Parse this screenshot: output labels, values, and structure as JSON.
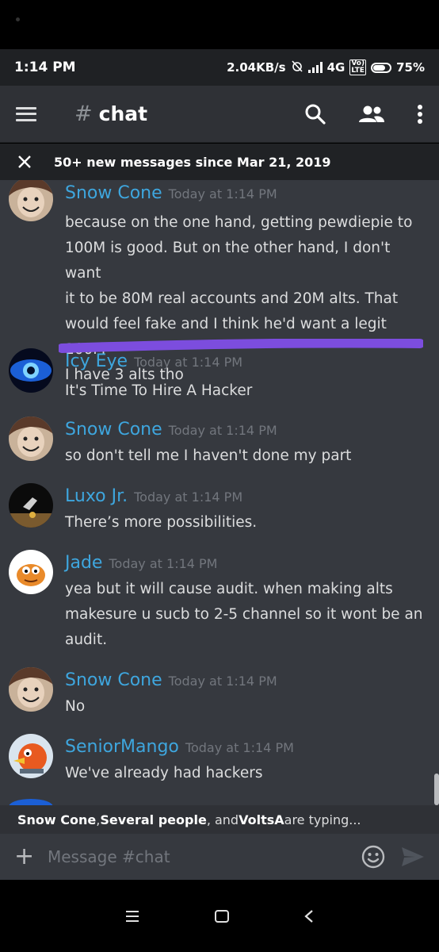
{
  "status": {
    "time": "1:14 PM",
    "network_speed": "2.04KB/s",
    "network_type": "4G",
    "lte_top": "Vo)",
    "lte_bottom": "LTE",
    "battery": "75%",
    "battery_level": 0.75
  },
  "header": {
    "hash": "#",
    "channel": "chat",
    "icons": [
      "menu-icon",
      "search-icon",
      "members-icon",
      "more-vertical-icon"
    ]
  },
  "banner": {
    "text": "50+ new messages since Mar 21, 2019"
  },
  "messages": [
    {
      "author": "Snow Cone",
      "author_color": "#3ea6de",
      "timestamp": "Today at 1:14 PM",
      "lines": [
        "because on the one hand, getting pewdiepie to",
        "100M is good. But on the other hand, I don't want",
        "it to be 80M real accounts and 20M alts. That",
        "would feel fake and I think he'd want a legit 100M",
        "I have 3 alts tho"
      ]
    },
    {
      "author": "Icy Eye",
      "author_color": "#3ea6de",
      "timestamp": "Today at 1:14 PM",
      "lines": [
        "It's Time To Hire A Hacker"
      ]
    },
    {
      "author": "Snow Cone",
      "author_color": "#3ea6de",
      "timestamp": "Today at 1:14 PM",
      "lines": [
        "so don't tell me I haven't done my part"
      ]
    },
    {
      "author": "Luxo Jr.",
      "author_color": "#3ea6de",
      "timestamp": "Today at 1:14 PM",
      "lines": [
        "There’s more possibilities."
      ]
    },
    {
      "author": "Jade",
      "author_color": "#3ea6de",
      "timestamp": "Today at 1:14 PM",
      "lines": [
        "yea but it will cause audit. when making alts",
        "makesure u sucb to 2-5 channel so it wont be an",
        "audit."
      ]
    },
    {
      "author": "Snow Cone",
      "author_color": "#3ea6de",
      "timestamp": "Today at 1:14 PM",
      "lines": [
        "No"
      ]
    },
    {
      "author": "SeniorMango",
      "author_color": "#3ea6de",
      "timestamp": "Today at 1:14 PM",
      "lines": [
        "We've already had hackers"
      ]
    }
  ],
  "typing": {
    "user1": "Snow Cone",
    "sep1": ", ",
    "user2": "Several people",
    "sep2": ", and ",
    "user3": "VoltsA",
    "suffix": " are typing..."
  },
  "composer": {
    "placeholder": "Message #chat"
  },
  "colors": {
    "accent_purple": "#7c4dde",
    "name_blue": "#3ea6de",
    "background": "#36393f"
  }
}
